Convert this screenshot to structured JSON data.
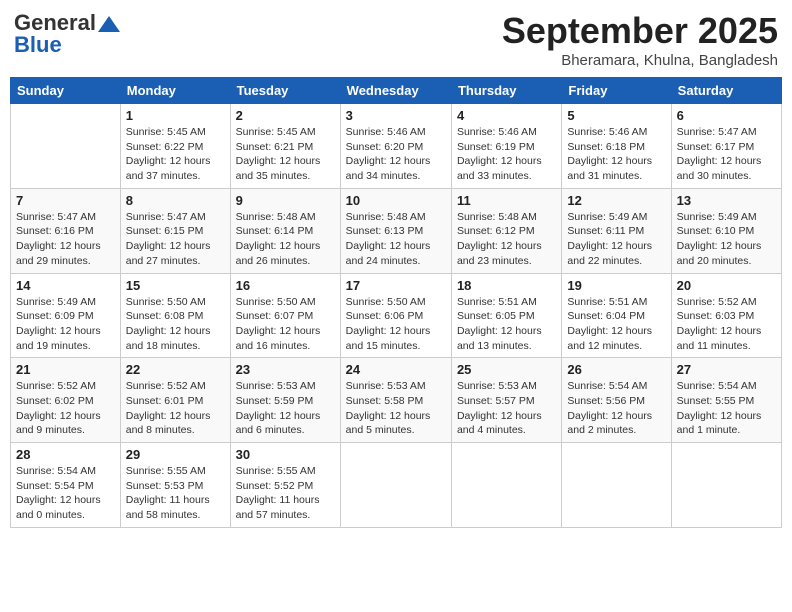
{
  "header": {
    "logo_general": "General",
    "logo_blue": "Blue",
    "month": "September 2025",
    "location": "Bheramara, Khulna, Bangladesh"
  },
  "columns": [
    "Sunday",
    "Monday",
    "Tuesday",
    "Wednesday",
    "Thursday",
    "Friday",
    "Saturday"
  ],
  "weeks": [
    [
      {
        "day": "",
        "info": ""
      },
      {
        "day": "1",
        "info": "Sunrise: 5:45 AM\nSunset: 6:22 PM\nDaylight: 12 hours\nand 37 minutes."
      },
      {
        "day": "2",
        "info": "Sunrise: 5:45 AM\nSunset: 6:21 PM\nDaylight: 12 hours\nand 35 minutes."
      },
      {
        "day": "3",
        "info": "Sunrise: 5:46 AM\nSunset: 6:20 PM\nDaylight: 12 hours\nand 34 minutes."
      },
      {
        "day": "4",
        "info": "Sunrise: 5:46 AM\nSunset: 6:19 PM\nDaylight: 12 hours\nand 33 minutes."
      },
      {
        "day": "5",
        "info": "Sunrise: 5:46 AM\nSunset: 6:18 PM\nDaylight: 12 hours\nand 31 minutes."
      },
      {
        "day": "6",
        "info": "Sunrise: 5:47 AM\nSunset: 6:17 PM\nDaylight: 12 hours\nand 30 minutes."
      }
    ],
    [
      {
        "day": "7",
        "info": "Sunrise: 5:47 AM\nSunset: 6:16 PM\nDaylight: 12 hours\nand 29 minutes."
      },
      {
        "day": "8",
        "info": "Sunrise: 5:47 AM\nSunset: 6:15 PM\nDaylight: 12 hours\nand 27 minutes."
      },
      {
        "day": "9",
        "info": "Sunrise: 5:48 AM\nSunset: 6:14 PM\nDaylight: 12 hours\nand 26 minutes."
      },
      {
        "day": "10",
        "info": "Sunrise: 5:48 AM\nSunset: 6:13 PM\nDaylight: 12 hours\nand 24 minutes."
      },
      {
        "day": "11",
        "info": "Sunrise: 5:48 AM\nSunset: 6:12 PM\nDaylight: 12 hours\nand 23 minutes."
      },
      {
        "day": "12",
        "info": "Sunrise: 5:49 AM\nSunset: 6:11 PM\nDaylight: 12 hours\nand 22 minutes."
      },
      {
        "day": "13",
        "info": "Sunrise: 5:49 AM\nSunset: 6:10 PM\nDaylight: 12 hours\nand 20 minutes."
      }
    ],
    [
      {
        "day": "14",
        "info": "Sunrise: 5:49 AM\nSunset: 6:09 PM\nDaylight: 12 hours\nand 19 minutes."
      },
      {
        "day": "15",
        "info": "Sunrise: 5:50 AM\nSunset: 6:08 PM\nDaylight: 12 hours\nand 18 minutes."
      },
      {
        "day": "16",
        "info": "Sunrise: 5:50 AM\nSunset: 6:07 PM\nDaylight: 12 hours\nand 16 minutes."
      },
      {
        "day": "17",
        "info": "Sunrise: 5:50 AM\nSunset: 6:06 PM\nDaylight: 12 hours\nand 15 minutes."
      },
      {
        "day": "18",
        "info": "Sunrise: 5:51 AM\nSunset: 6:05 PM\nDaylight: 12 hours\nand 13 minutes."
      },
      {
        "day": "19",
        "info": "Sunrise: 5:51 AM\nSunset: 6:04 PM\nDaylight: 12 hours\nand 12 minutes."
      },
      {
        "day": "20",
        "info": "Sunrise: 5:52 AM\nSunset: 6:03 PM\nDaylight: 12 hours\nand 11 minutes."
      }
    ],
    [
      {
        "day": "21",
        "info": "Sunrise: 5:52 AM\nSunset: 6:02 PM\nDaylight: 12 hours\nand 9 minutes."
      },
      {
        "day": "22",
        "info": "Sunrise: 5:52 AM\nSunset: 6:01 PM\nDaylight: 12 hours\nand 8 minutes."
      },
      {
        "day": "23",
        "info": "Sunrise: 5:53 AM\nSunset: 5:59 PM\nDaylight: 12 hours\nand 6 minutes."
      },
      {
        "day": "24",
        "info": "Sunrise: 5:53 AM\nSunset: 5:58 PM\nDaylight: 12 hours\nand 5 minutes."
      },
      {
        "day": "25",
        "info": "Sunrise: 5:53 AM\nSunset: 5:57 PM\nDaylight: 12 hours\nand 4 minutes."
      },
      {
        "day": "26",
        "info": "Sunrise: 5:54 AM\nSunset: 5:56 PM\nDaylight: 12 hours\nand 2 minutes."
      },
      {
        "day": "27",
        "info": "Sunrise: 5:54 AM\nSunset: 5:55 PM\nDaylight: 12 hours\nand 1 minute."
      }
    ],
    [
      {
        "day": "28",
        "info": "Sunrise: 5:54 AM\nSunset: 5:54 PM\nDaylight: 12 hours\nand 0 minutes."
      },
      {
        "day": "29",
        "info": "Sunrise: 5:55 AM\nSunset: 5:53 PM\nDaylight: 11 hours\nand 58 minutes."
      },
      {
        "day": "30",
        "info": "Sunrise: 5:55 AM\nSunset: 5:52 PM\nDaylight: 11 hours\nand 57 minutes."
      },
      {
        "day": "",
        "info": ""
      },
      {
        "day": "",
        "info": ""
      },
      {
        "day": "",
        "info": ""
      },
      {
        "day": "",
        "info": ""
      }
    ]
  ]
}
